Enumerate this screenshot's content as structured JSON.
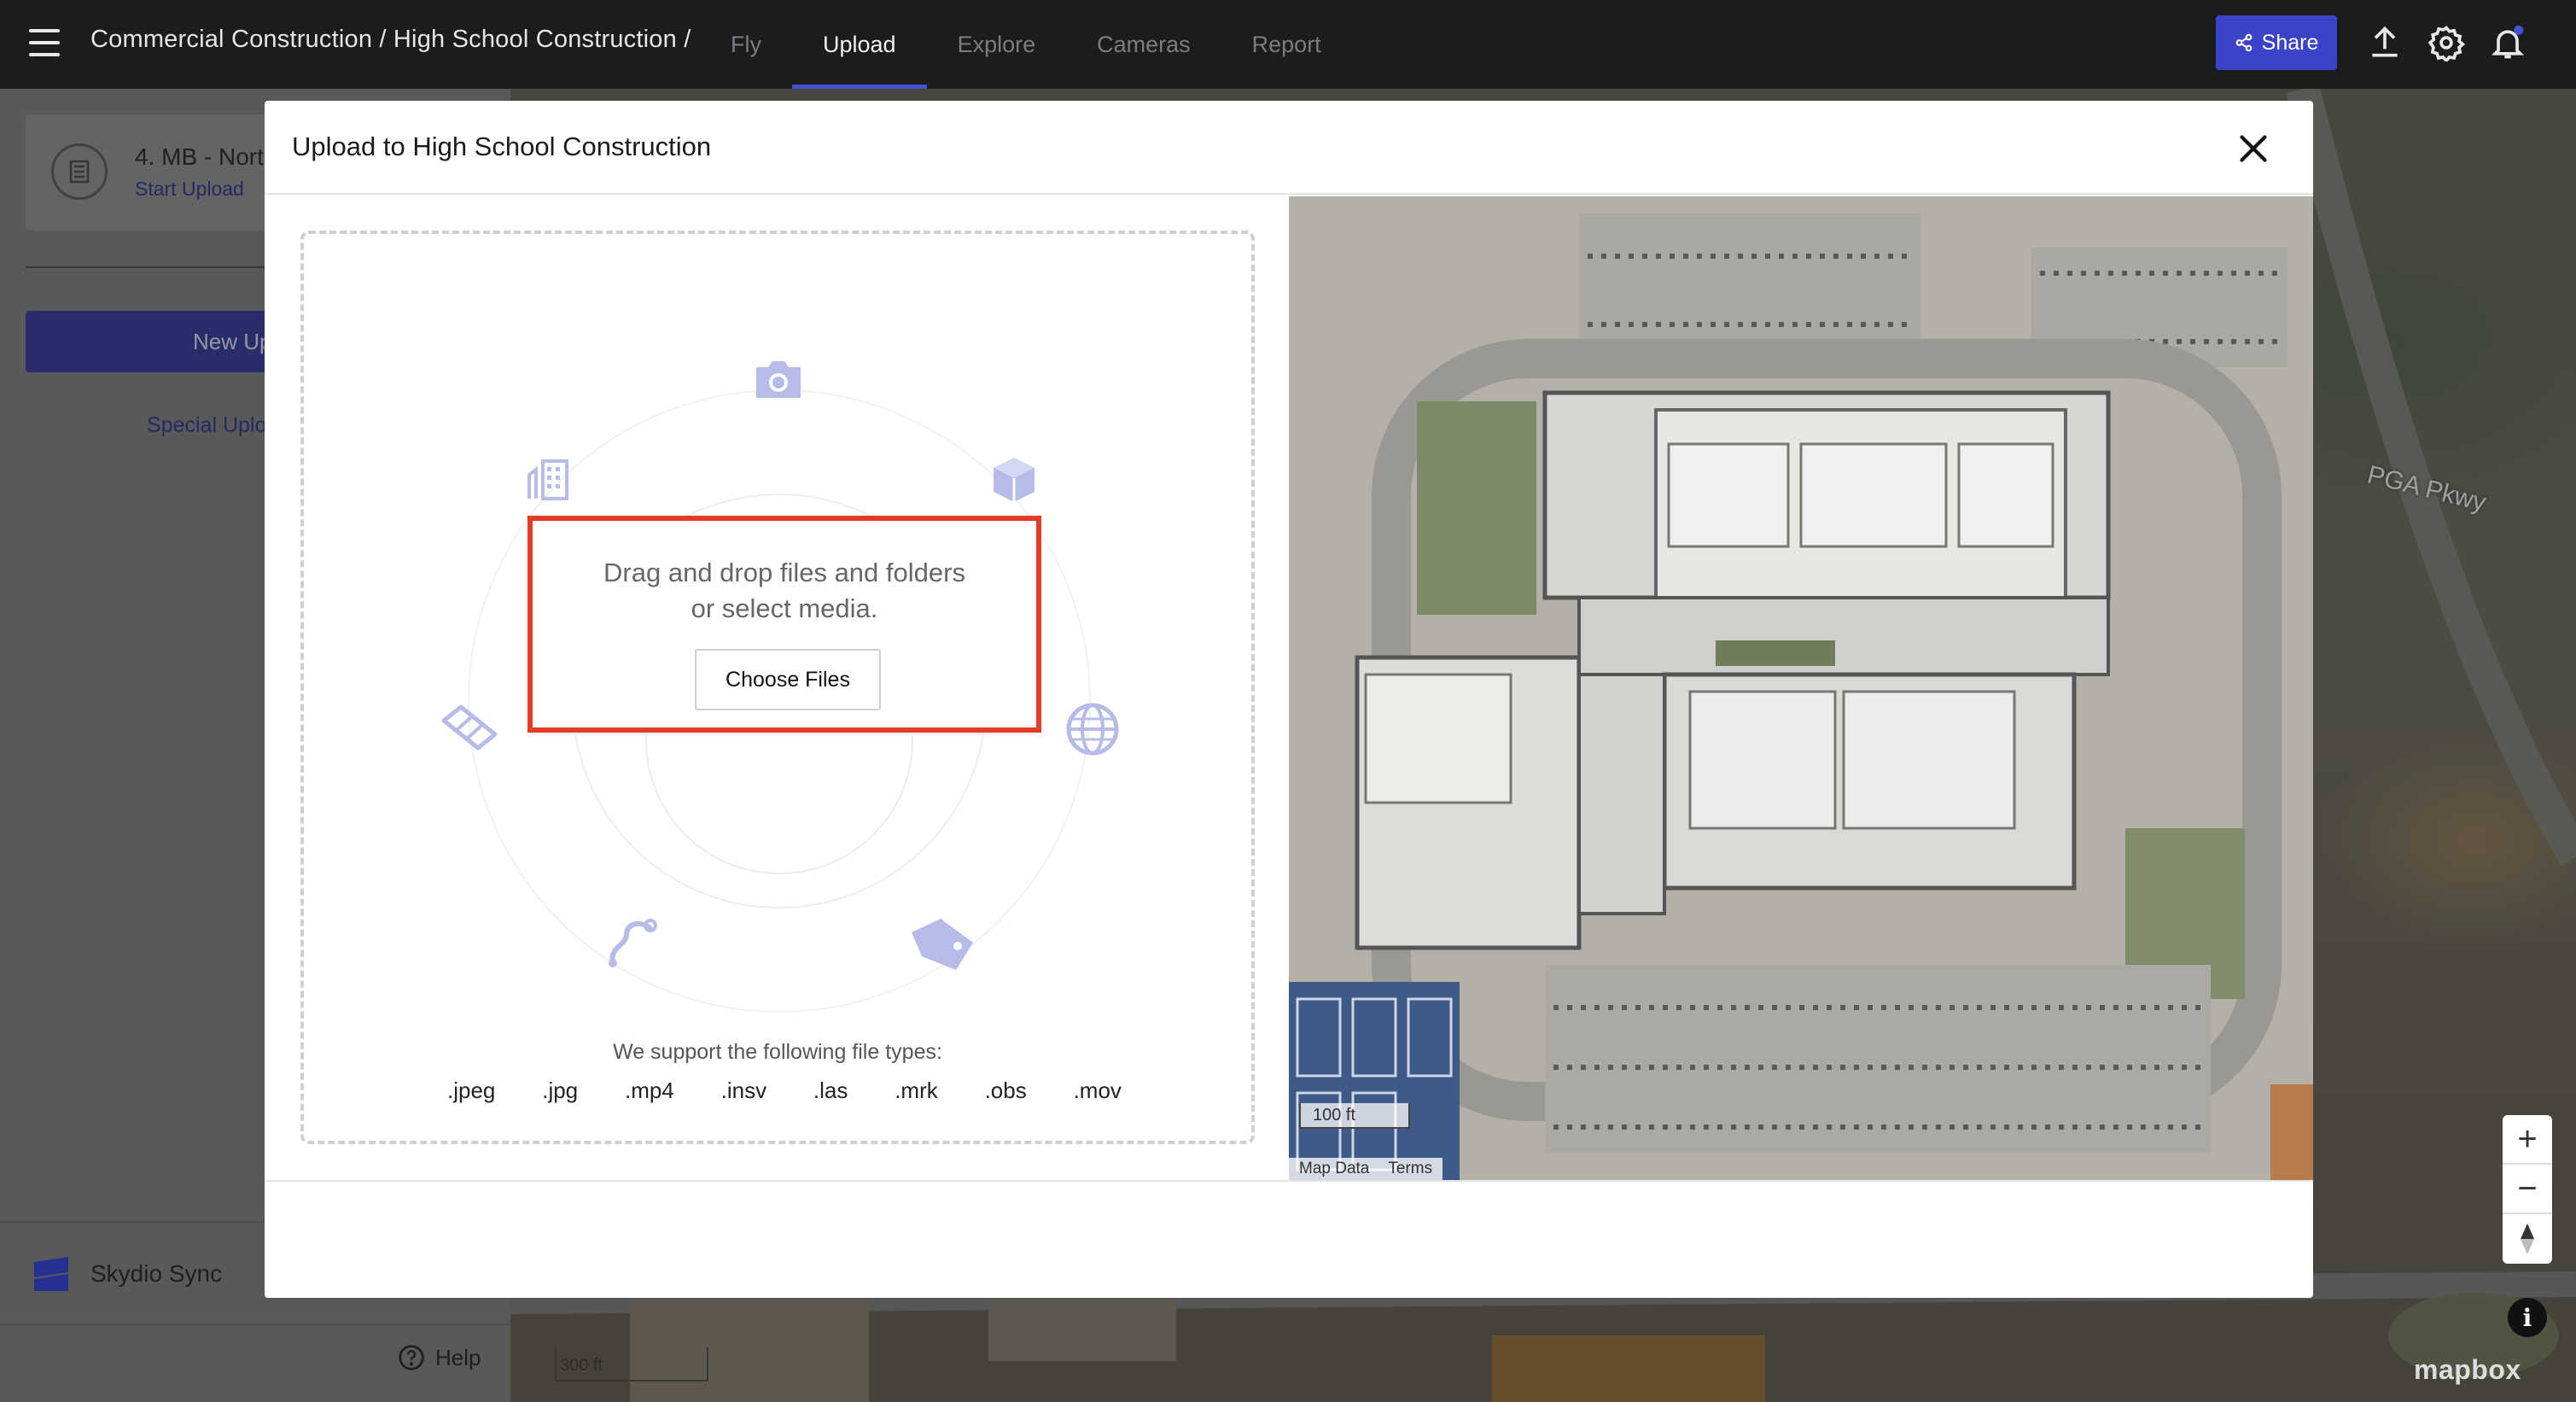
{
  "topbar": {
    "breadcrumb": "Commercial Construction / High School Construction /",
    "tabs": [
      {
        "label": "Fly"
      },
      {
        "label": "Upload"
      },
      {
        "label": "Explore"
      },
      {
        "label": "Cameras"
      },
      {
        "label": "Report"
      }
    ],
    "active_tab": "Upload",
    "share_label": "Share",
    "accent_color": "#3b44c9"
  },
  "sidebar": {
    "upload_item_title": "4. MB - Nort",
    "upload_item_action": "Start Upload",
    "new_upload_label": "New Up",
    "special_upload_label": "Special Uplo",
    "sync_label": "Skydio Sync",
    "help_label": "Help"
  },
  "modal": {
    "title": "Upload to High School Construction",
    "drop_text_line1": "Drag and drop files and folders",
    "drop_text_line2": "or select media.",
    "choose_files_label": "Choose Files",
    "support_text": "We support the following file types:",
    "file_types": [
      ".jpeg",
      ".jpg",
      ".mp4",
      ".insv",
      ".las",
      ".mrk",
      ".obs",
      ".mov"
    ],
    "highlight_color": "#e33b26"
  },
  "map": {
    "road_label": "PGA Pkwy",
    "modal_scale": "100 ft",
    "bg_scale": "300 ft",
    "map_data_link": "Map Data",
    "terms_link": "Terms",
    "brand": "mapbox",
    "zoom_in": "+",
    "zoom_out": "−",
    "info": "i"
  },
  "icons": [
    "hamburger-icon",
    "share-icon",
    "upload-icon",
    "gear-icon",
    "bell-icon",
    "camera-icon",
    "building-icon",
    "cube-icon",
    "globe-icon",
    "map-icon",
    "path-icon",
    "tag-icon",
    "close-icon",
    "help-icon"
  ]
}
